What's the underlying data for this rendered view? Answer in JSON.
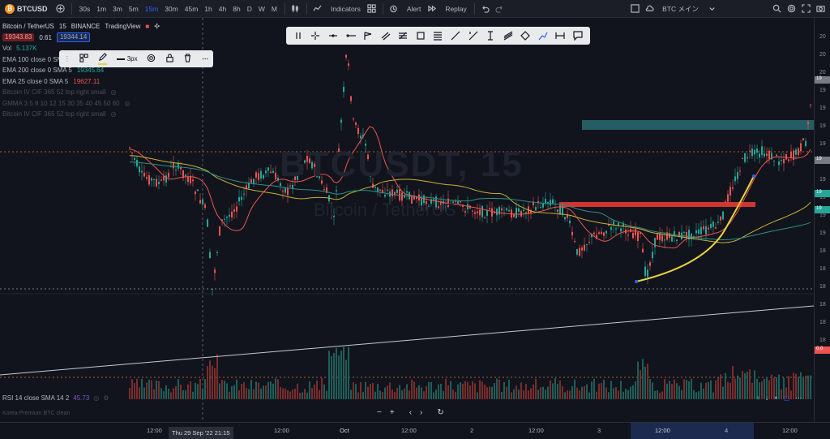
{
  "topbar": {
    "symbol": "BTCUSD",
    "intervals": [
      "30s",
      "1m",
      "3m",
      "5m",
      "15m",
      "30m",
      "45m",
      "1h",
      "4h",
      "8h",
      "D",
      "W",
      "M"
    ],
    "active_interval": "15m",
    "indicators_label": "Indicators",
    "alert_label": "Alert",
    "replay_label": "Replay",
    "layout_label": "BTC メイン"
  },
  "legend": {
    "title": "Bitcoin / TetherUS",
    "interval": "15",
    "exchange": "BINANCE",
    "source": "TradingView",
    "bid": "19343.83",
    "spread": "0.61",
    "ask": "19344.14",
    "vol_label": "Vol",
    "vol_value": "5.137K",
    "ema100": "EMA 100 close 0 SMA 5",
    "ema200": "EMA 200 close 0 SMA 5",
    "ema200_value": "19345.64",
    "ema25": "EMA 25 close 0 SMA 5",
    "ema25_value": "19627.11",
    "hidden1": "Bitcoin IV CIF 365 52 top right small",
    "hidden2": "GMMA 3 5 8 10 12 15 30 35 40 45 50 60",
    "hidden3": "Bitcoin IV CIF 365 52 top right small"
  },
  "floatbar": {
    "width_label": "3px"
  },
  "watermark": {
    "line1": "BTCUSDT, 15",
    "line2": "Bitcoin / TetherUS"
  },
  "rsi": {
    "label": "RSI 14 close SMA 14 2",
    "value": "45.73"
  },
  "kimchi": {
    "label": "Korea Premium BTC clean"
  },
  "price_scale": [
    "20",
    "20",
    "20",
    "19",
    "19",
    "19",
    "19",
    "19",
    "19",
    "19",
    "19",
    "19",
    "18",
    "18",
    "18",
    "18",
    "18",
    "18"
  ],
  "price_tags": [
    "19",
    "19",
    "19",
    "19",
    "0.0"
  ],
  "time_axis": {
    "labels": [
      "12:00",
      "12:00",
      "Oct",
      "12:00",
      "2",
      "12:00",
      "3",
      "12:00",
      "4",
      "12:00"
    ],
    "crosshair": "Thu 29 Sep '22  21:15",
    "highlight": "12:00"
  },
  "colors": {
    "up": "#26a69a",
    "down": "#ef5350",
    "ema25": "#ef5350",
    "ema100": "#c9b037",
    "ema200": "#2d8f86",
    "trend": "#e8d23f",
    "zone_red": "#e53935",
    "zone_teal": "#2a6f78",
    "accent": "#2962ff"
  }
}
